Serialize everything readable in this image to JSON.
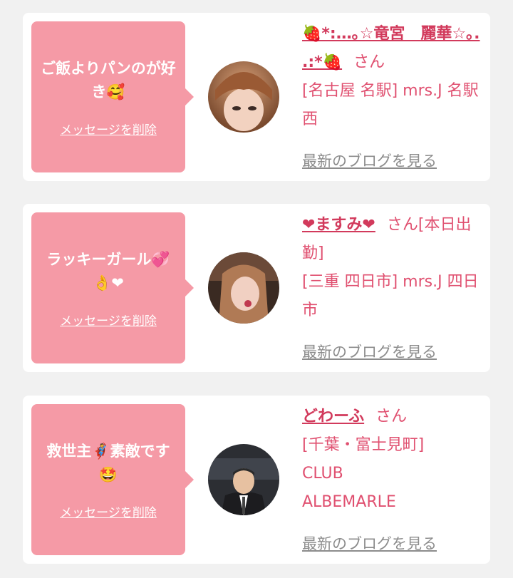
{
  "cards": [
    {
      "message": "ご飯よりパンのが好き🥰",
      "delete_label": "メッセージを削除",
      "name": "🍓*:…｡☆竜宮　麗華☆｡. .:*🍓",
      "san": "さん",
      "location": "[名古屋 名駅] mrs.J 名駅西",
      "blog_link": "最新のブログを見る"
    },
    {
      "message": "ラッキーガール💞👌❤",
      "delete_label": "メッセージを削除",
      "name": "❤ますみ❤",
      "san": "さん[本日出勤]",
      "location": "[三重 四日市] mrs.J 四日市",
      "blog_link": "最新のブログを見る"
    },
    {
      "message": "救世主🦸素敵です🤩",
      "delete_label": "メッセージを削除",
      "name": "どわーふ",
      "san": "さん",
      "location": "[千葉・富士見町] CLUB ALBEMARLE",
      "blog_link": "最新のブログを見る"
    }
  ]
}
